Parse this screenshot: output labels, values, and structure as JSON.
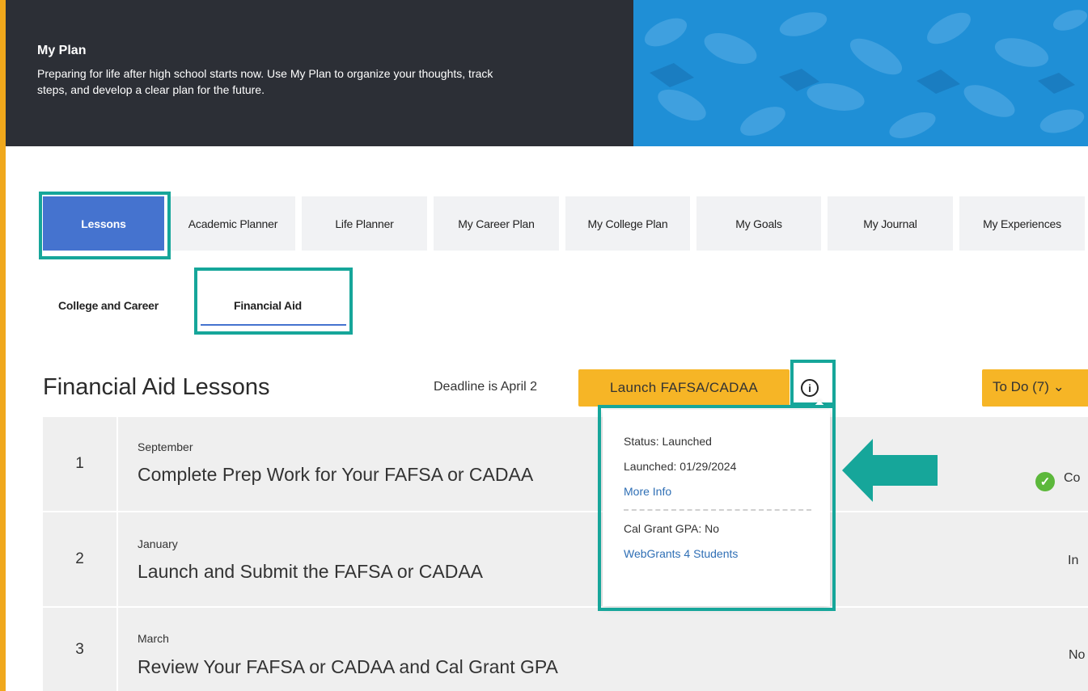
{
  "banner": {
    "title": "My Plan",
    "description": "Preparing for life after high school starts now. Use My Plan to organize your thoughts, track steps, and develop a clear plan for the future."
  },
  "tabs": [
    {
      "label": "Lessons",
      "active": true
    },
    {
      "label": "Academic Planner",
      "active": false
    },
    {
      "label": "Life Planner",
      "active": false
    },
    {
      "label": "My Career Plan",
      "active": false
    },
    {
      "label": "My College Plan",
      "active": false
    },
    {
      "label": "My Goals",
      "active": false
    },
    {
      "label": "My Journal",
      "active": false
    },
    {
      "label": "My Experiences",
      "active": false
    }
  ],
  "subtabs": [
    {
      "label": "College and Career",
      "active": false
    },
    {
      "label": "Financial Aid",
      "active": true
    }
  ],
  "lessons_header": {
    "title": "Financial Aid Lessons",
    "deadline": "Deadline is April 2",
    "launch_button": "Launch FAFSA/CADAA",
    "info_icon": "ⓘ",
    "todo_button": "To Do (7) ⌄"
  },
  "popover": {
    "status": "Status: Launched",
    "launched": "Launched: 01/29/2024",
    "more_info": "More Info",
    "cal_grant": "Cal Grant GPA: No",
    "webgrants": "WebGrants 4 Students"
  },
  "lessons": [
    {
      "number": "1",
      "month": "September",
      "title": "Complete Prep Work for Your FAFSA or CADAA",
      "status": "Co"
    },
    {
      "number": "2",
      "month": "January",
      "title": "Launch and Submit the FAFSA or CADAA",
      "status": "In"
    },
    {
      "number": "3",
      "month": "March",
      "title": "Review Your FAFSA or CADAA and Cal Grant GPA",
      "status": "No"
    }
  ],
  "colors": {
    "accent_blue": "#4573cf",
    "highlight_teal": "#16a69a",
    "button_gold": "#f6b526",
    "banner_dark": "#2c2f36"
  }
}
